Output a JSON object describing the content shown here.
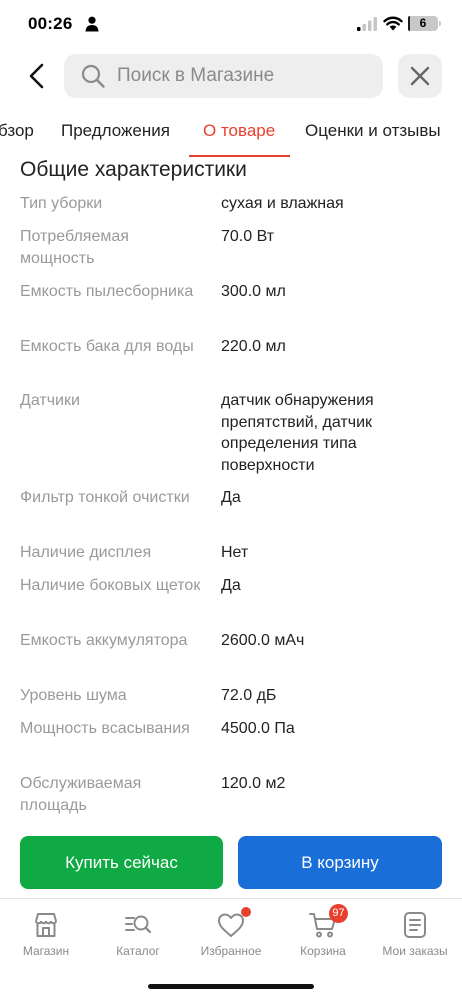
{
  "status_bar": {
    "time": "00:26",
    "battery_level": "6",
    "battery_fraction": 0.06
  },
  "search": {
    "placeholder": "Поиск в Магазине"
  },
  "tabs": [
    {
      "label": "бзор"
    },
    {
      "label": "Предложения"
    },
    {
      "label": "О товаре",
      "active": true
    },
    {
      "label": "Оценки и отзывы"
    }
  ],
  "section": {
    "title": "Общие характеристики"
  },
  "specs": [
    {
      "label": "Тип уборки",
      "value": "сухая и влажная"
    },
    {
      "label": "Потребляемая мощность",
      "value": "70.0 Вт"
    },
    {
      "label": "Емкость пылесборника",
      "value": "300.0 мл"
    },
    {
      "label": "Емкость бака для воды",
      "value": "220.0 мл"
    },
    {
      "label": "Датчики",
      "value": "датчик обнаружения препятствий, датчик определения типа поверхности"
    },
    {
      "label": "Фильтр тонкой очистки",
      "value": "Да"
    },
    {
      "label": "Наличие дисплея",
      "value": "Нет"
    },
    {
      "label": "Наличие боковых щеток",
      "value": "Да"
    },
    {
      "label": "Емкость аккумулятора",
      "value": "2600.0 мАч"
    },
    {
      "label": "Уровень шума",
      "value": "72.0 дБ"
    },
    {
      "label": "Мощность всасывания",
      "value": "4500.0 Па"
    },
    {
      "label": "Обслуживаемая площадь",
      "value": "120.0 м2"
    }
  ],
  "actions": {
    "buy_now": "Купить сейчас",
    "add_to_cart": "В корзину"
  },
  "bottom_nav": [
    {
      "label": "Магазин",
      "icon": "store-icon"
    },
    {
      "label": "Каталог",
      "icon": "catalog-search-icon"
    },
    {
      "label": "Избранное",
      "icon": "heart-icon"
    },
    {
      "label": "Корзина",
      "icon": "cart-icon",
      "badge": "97"
    },
    {
      "label": "Мои заказы",
      "icon": "orders-icon"
    }
  ],
  "colors": {
    "accent": "#e8402f",
    "buy_button": "#0faa44",
    "cart_button": "#1a6ed8"
  }
}
